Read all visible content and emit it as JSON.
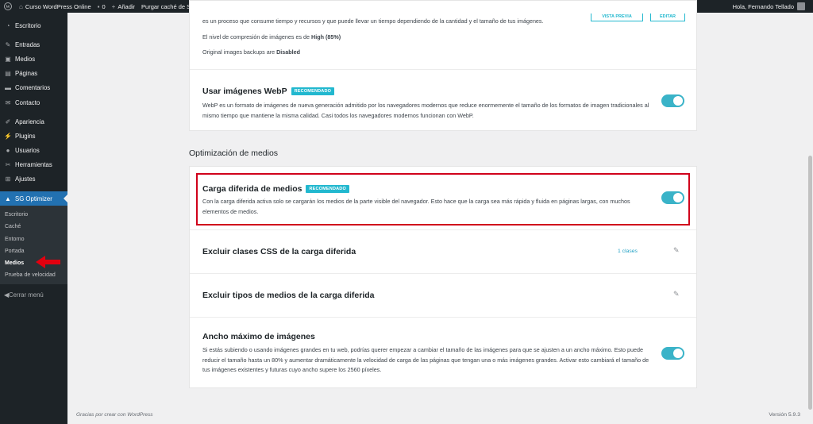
{
  "adminbar": {
    "site_name": "Curso WordPress Online",
    "comments_count": "0",
    "add_new": "Añadir",
    "purge_cache": "Purgar caché de SG",
    "greeting": "Hola, Fernando Tellado"
  },
  "sidebar": {
    "items": [
      {
        "label": "Escritorio",
        "icon": "dashboard-icon"
      },
      {
        "label": "Entradas",
        "icon": "pin-icon"
      },
      {
        "label": "Medios",
        "icon": "media-icon"
      },
      {
        "label": "Páginas",
        "icon": "pages-icon"
      },
      {
        "label": "Comentarios",
        "icon": "comment-icon"
      },
      {
        "label": "Contacto",
        "icon": "mail-icon"
      },
      {
        "label": "Apariencia",
        "icon": "brush-icon"
      },
      {
        "label": "Plugins",
        "icon": "plugin-icon"
      },
      {
        "label": "Usuarios",
        "icon": "users-icon"
      },
      {
        "label": "Herramientas",
        "icon": "wrench-icon"
      },
      {
        "label": "Ajustes",
        "icon": "settings-icon"
      },
      {
        "label": "SG Optimizer",
        "icon": "sg-optimizer-icon"
      }
    ],
    "submenu": [
      "Escritorio",
      "Caché",
      "Entorno",
      "Portada",
      "Medios",
      "Prueba de velocidad"
    ],
    "collapse": "Cerrar menú"
  },
  "card1": {
    "compress_text": "es un proceso que consume tiempo y recursos y que puede llevar un tiempo dependiendo de la cantidad y el tamaño de tus imágenes.",
    "btn_preview": "VISTA PREVIA",
    "btn_edit": "EDITAR",
    "level_prefix": "El nivel de compresión de imágenes es de ",
    "level_value": "High (85%)",
    "backup_prefix": "Original images backups are ",
    "backup_value": "Disabled",
    "webp_title": "Usar imágenes WebP",
    "badge": "RECOMENDADO",
    "webp_text": "WebP es un formato de imágenes de nueva generación admitido por los navegadores modernos que reduce enormemente el tamaño de los formatos de imagen tradicionales al mismo tiempo que mantiene la misma calidad. Casi todos los navegadores modernos funcionan con WebP."
  },
  "section_title": "Optimización de medios",
  "card2": {
    "lazy_title": "Carga diferida de medios",
    "badge": "RECOMENDADO",
    "lazy_text": "Con la carga diferida activa solo se cargarán los medios de la parte visible del navegador. Esto hace que la carga sea más rápida y fluida en páginas largas, con muchos elementos de medios.",
    "exclude_css_title": "Excluir clases CSS de la carga diferida",
    "exclude_css_count": "1 clases",
    "exclude_types_title": "Excluir tipos de medios de la carga diferida",
    "max_width_title": "Ancho máximo de imágenes",
    "max_width_text": "Si estás subiendo o usando imágenes grandes en tu web, podrías querer empezar a cambiar el tamaño de las imágenes para que se ajusten a un ancho máximo. Esto puede reducir el tamaño hasta un 80% y aumentar dramáticamente la velocidad de carga de las páginas que tengan una o más imágenes grandes. Activar esto cambiará el tamaño de tus imágenes existentes y futuras cuyo ancho supere los 2560 píxeles."
  },
  "footer": {
    "thanks": "Gracias por crear con WordPress",
    "version": "Versión 5.9.3"
  },
  "colors": {
    "accent": "#22b8cf",
    "toggle": "#3ab3c8",
    "highlight": "#d0021b",
    "admin_dark": "#1d2327",
    "wp_blue": "#2271b1"
  }
}
